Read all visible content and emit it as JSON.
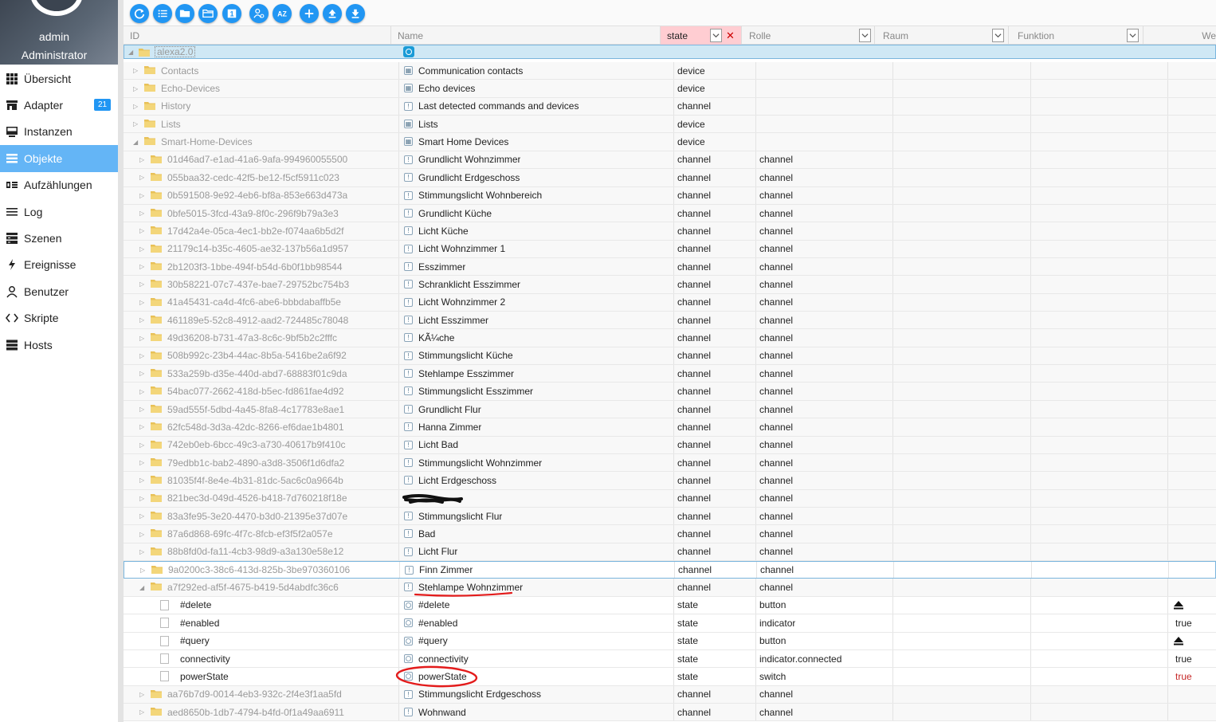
{
  "user": {
    "name": "admin",
    "role": "Administrator"
  },
  "nav": [
    {
      "label": "Übersicht",
      "icon": "grid-icon"
    },
    {
      "label": "Adapter",
      "icon": "store-icon",
      "badge": "21"
    },
    {
      "label": "Instanzen",
      "icon": "monitor-icon"
    },
    {
      "label": "Objekte",
      "icon": "list-icon",
      "active": true
    },
    {
      "label": "Aufzählungen",
      "icon": "enum-icon"
    },
    {
      "label": "Log",
      "icon": "menu-icon"
    },
    {
      "label": "Szenen",
      "icon": "scenes-icon"
    },
    {
      "label": "Ereignisse",
      "icon": "bolt-icon"
    },
    {
      "label": "Benutzer",
      "icon": "user-icon"
    },
    {
      "label": "Skripte",
      "icon": "code-icon"
    },
    {
      "label": "Hosts",
      "icon": "hosts-icon"
    }
  ],
  "toolbar": [
    {
      "name": "refresh-button",
      "icon": "refresh-icon"
    },
    {
      "name": "list-view-button",
      "icon": "list-icon"
    },
    {
      "name": "folder-collapse-button",
      "icon": "folder-icon"
    },
    {
      "name": "folder-expand-button",
      "icon": "folder-open-icon"
    },
    {
      "name": "counter-button",
      "icon": "counter-icon",
      "text": "1"
    },
    {
      "name": "user-config-button",
      "icon": "person-gear-icon"
    },
    {
      "name": "sort-az-button",
      "icon": "sort-az-icon",
      "text": "AZ"
    },
    {
      "name": "add-button",
      "icon": "plus-icon"
    },
    {
      "name": "upload-button",
      "icon": "upload-icon"
    },
    {
      "name": "download-button",
      "icon": "download-icon"
    }
  ],
  "header": {
    "id_placeholder": "ID",
    "name_placeholder": "Name",
    "type_filter": "state",
    "role_filter": "Rolle",
    "room_filter": "Raum",
    "function_filter": "Funktion",
    "value_label": "We"
  },
  "root": {
    "id": "alexa2.0"
  },
  "rows": [
    {
      "id": "Contacts",
      "name": "Communication contacts",
      "type": "device",
      "role": "",
      "value": "",
      "level": 1,
      "kind": "folder",
      "icon": "device"
    },
    {
      "id": "Echo-Devices",
      "name": "Echo devices",
      "type": "device",
      "role": "",
      "value": "",
      "level": 1,
      "kind": "folder",
      "icon": "device"
    },
    {
      "id": "History",
      "name": "Last detected commands and devices",
      "type": "channel",
      "role": "",
      "value": "",
      "level": 1,
      "kind": "folder",
      "icon": "channel"
    },
    {
      "id": "Lists",
      "name": "Lists",
      "type": "device",
      "role": "",
      "value": "",
      "level": 1,
      "kind": "folder",
      "icon": "device"
    },
    {
      "id": "Smart-Home-Devices",
      "name": "Smart Home Devices",
      "type": "device",
      "role": "",
      "value": "",
      "level": 1,
      "kind": "folder",
      "icon": "device",
      "expanded": true
    },
    {
      "id": "01d46ad7-e1ad-41a6-9afa-994960055500",
      "name": "Grundlicht Wohnzimmer",
      "type": "channel",
      "role": "channel",
      "value": "",
      "level": 2,
      "kind": "folder",
      "icon": "channel"
    },
    {
      "id": "055baa32-cedc-42f5-be12-f5cf5911c023",
      "name": "Grundlicht Erdgeschoss",
      "type": "channel",
      "role": "channel",
      "value": "",
      "level": 2,
      "kind": "folder",
      "icon": "channel"
    },
    {
      "id": "0b591508-9e92-4eb6-bf8a-853e663d473a",
      "name": "Stimmungslicht Wohnbereich",
      "type": "channel",
      "role": "channel",
      "value": "",
      "level": 2,
      "kind": "folder",
      "icon": "channel"
    },
    {
      "id": "0bfe5015-3fcd-43a9-8f0c-296f9b79a3e3",
      "name": "Grundlicht Küche",
      "type": "channel",
      "role": "channel",
      "value": "",
      "level": 2,
      "kind": "folder",
      "icon": "channel"
    },
    {
      "id": "17d42a4e-05ca-4ec1-bb2e-f074aa6b5d2f",
      "name": "Licht Küche",
      "type": "channel",
      "role": "channel",
      "value": "",
      "level": 2,
      "kind": "folder",
      "icon": "channel"
    },
    {
      "id": "21179c14-b35c-4605-ae32-137b56a1d957",
      "name": "Licht Wohnzimmer 1",
      "type": "channel",
      "role": "channel",
      "value": "",
      "level": 2,
      "kind": "folder",
      "icon": "channel"
    },
    {
      "id": "2b1203f3-1bbe-494f-b54d-6b0f1bb98544",
      "name": "Esszimmer",
      "type": "channel",
      "role": "channel",
      "value": "",
      "level": 2,
      "kind": "folder",
      "icon": "channel"
    },
    {
      "id": "30b58221-07c7-437e-bae7-29752bc754b3",
      "name": "Schranklicht Esszimmer",
      "type": "channel",
      "role": "channel",
      "value": "",
      "level": 2,
      "kind": "folder",
      "icon": "channel"
    },
    {
      "id": "41a45431-ca4d-4fc6-abe6-bbbdabaffb5e",
      "name": "Licht Wohnzimmer 2",
      "type": "channel",
      "role": "channel",
      "value": "",
      "level": 2,
      "kind": "folder",
      "icon": "channel"
    },
    {
      "id": "461189e5-52c8-4912-aad2-724485c78048",
      "name": "Licht Esszimmer",
      "type": "channel",
      "role": "channel",
      "value": "",
      "level": 2,
      "kind": "folder",
      "icon": "channel"
    },
    {
      "id": "49d36208-b731-47a3-8c6c-9bf5b2c2fffc",
      "name": "KÃ¼che",
      "type": "channel",
      "role": "channel",
      "value": "",
      "level": 2,
      "kind": "folder",
      "icon": "channel"
    },
    {
      "id": "508b992c-23b4-44ac-8b5a-5416be2a6f92",
      "name": "Stimmungslicht Küche",
      "type": "channel",
      "role": "channel",
      "value": "",
      "level": 2,
      "kind": "folder",
      "icon": "channel"
    },
    {
      "id": "533a259b-d35e-440d-abd7-68883f01c9da",
      "name": "Stehlampe Esszimmer",
      "type": "channel",
      "role": "channel",
      "value": "",
      "level": 2,
      "kind": "folder",
      "icon": "channel"
    },
    {
      "id": "54bac077-2662-418d-b5ec-fd861fae4d92",
      "name": "Stimmungslicht Esszimmer",
      "type": "channel",
      "role": "channel",
      "value": "",
      "level": 2,
      "kind": "folder",
      "icon": "channel"
    },
    {
      "id": "59ad555f-5dbd-4a45-8fa8-4c17783e8ae1",
      "name": "Grundlicht Flur",
      "type": "channel",
      "role": "channel",
      "value": "",
      "level": 2,
      "kind": "folder",
      "icon": "channel"
    },
    {
      "id": "62fc548d-3d3a-42dc-8266-ef6dae1b4801",
      "name": "Hanna Zimmer",
      "type": "channel",
      "role": "channel",
      "value": "",
      "level": 2,
      "kind": "folder",
      "icon": "channel"
    },
    {
      "id": "742eb0eb-6bcc-49c3-a730-40617b9f410c",
      "name": "Licht Bad",
      "type": "channel",
      "role": "channel",
      "value": "",
      "level": 2,
      "kind": "folder",
      "icon": "channel"
    },
    {
      "id": "79edbb1c-bab2-4890-a3d8-3506f1d6dfa2",
      "name": "Stimmungslicht Wohnzimmer",
      "type": "channel",
      "role": "channel",
      "value": "",
      "level": 2,
      "kind": "folder",
      "icon": "channel"
    },
    {
      "id": "81035f4f-8e4e-4b31-81dc-5ac6c0a9664b",
      "name": "Licht Erdgeschoss",
      "type": "channel",
      "role": "channel",
      "value": "",
      "level": 2,
      "kind": "folder",
      "icon": "channel"
    },
    {
      "id": "821bec3d-049d-4526-b418-7d760218f18e",
      "name": "",
      "type": "channel",
      "role": "channel",
      "value": "",
      "level": 2,
      "kind": "folder",
      "icon": "none",
      "redacted": true
    },
    {
      "id": "83a3fe95-3e20-4470-b3d0-21395e37d07e",
      "name": "Stimmungslicht Flur",
      "type": "channel",
      "role": "channel",
      "value": "",
      "level": 2,
      "kind": "folder",
      "icon": "channel"
    },
    {
      "id": "87a6d868-69fc-4f7c-8fcb-ef3f5f2a057e",
      "name": "Bad",
      "type": "channel",
      "role": "channel",
      "value": "",
      "level": 2,
      "kind": "folder",
      "icon": "channel"
    },
    {
      "id": "88b8fd0d-fa11-4cb3-98d9-a3a130e58e12",
      "name": "Licht Flur",
      "type": "channel",
      "role": "channel",
      "value": "",
      "level": 2,
      "kind": "folder",
      "icon": "channel"
    },
    {
      "id": "9a0200c3-38c6-413d-825b-3be970360106",
      "name": "Finn Zimmer",
      "type": "channel",
      "role": "channel",
      "value": "",
      "level": 2,
      "kind": "folder",
      "icon": "channel",
      "selected": true
    },
    {
      "id": "a7f292ed-af5f-4675-b419-5d4abdfc36c6",
      "name": "Stehlampe Wohnzimmer",
      "type": "channel",
      "role": "channel",
      "value": "",
      "level": 2,
      "kind": "folder",
      "icon": "channel",
      "expanded": true
    },
    {
      "id": "#delete",
      "name": "#delete",
      "type": "state",
      "role": "button",
      "value": "",
      "level": 3,
      "kind": "leaf",
      "icon": "state",
      "value_icon": "eject"
    },
    {
      "id": "#enabled",
      "name": "#enabled",
      "type": "state",
      "role": "indicator",
      "value": "true",
      "level": 3,
      "kind": "leaf",
      "icon": "state"
    },
    {
      "id": "#query",
      "name": "#query",
      "type": "state",
      "role": "button",
      "value": "",
      "level": 3,
      "kind": "leaf",
      "icon": "state",
      "value_icon": "eject"
    },
    {
      "id": "connectivity",
      "name": "connectivity",
      "type": "state",
      "role": "indicator.connected",
      "value": "true",
      "level": 3,
      "kind": "leaf",
      "icon": "state"
    },
    {
      "id": "powerState",
      "name": "powerState",
      "type": "state",
      "role": "switch",
      "value": "true",
      "level": 3,
      "kind": "leaf",
      "icon": "state",
      "value_color": "#c62828"
    },
    {
      "id": "aa76b7d9-0014-4eb3-932c-2f4e3f1aa5fd",
      "name": "Stimmungslicht Erdgeschoss",
      "type": "channel",
      "role": "channel",
      "value": "",
      "level": 2,
      "kind": "folder",
      "icon": "channel"
    },
    {
      "id": "aed8650b-1db7-4794-b4fd-0f1a49aa6911",
      "name": "Wohnwand",
      "type": "channel",
      "role": "channel",
      "value": "",
      "level": 2,
      "kind": "folder",
      "icon": "channel"
    }
  ],
  "colors": {
    "accent": "#2196f3",
    "nav_active": "#64b5f6",
    "state_filter_bg": "#ffcdd2",
    "selected_row_border": "#7ab5dd",
    "annotation": "#e31b1b",
    "folder": "#e8c158"
  }
}
